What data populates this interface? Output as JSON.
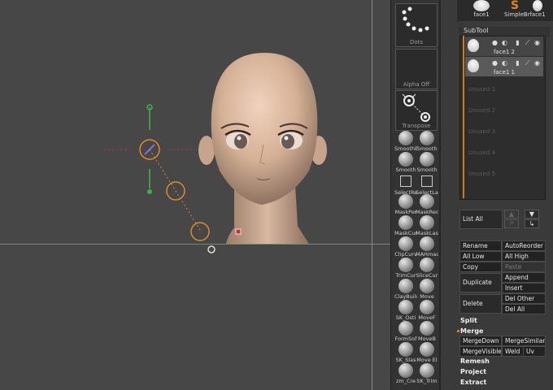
{
  "palette": {
    "dots_label": "Dots",
    "alpha_label": "Alpha Off",
    "transpose_label": "Transpose",
    "brushes": [
      {
        "label": "SmoothE"
      },
      {
        "label": "Smooth"
      },
      {
        "label": "Smooth"
      },
      {
        "label": "Smooth"
      },
      {
        "label": "SelectRe"
      },
      {
        "label": "SelectLa"
      },
      {
        "label": "MaskPer"
      },
      {
        "label": "MaskRec"
      },
      {
        "label": "MaskCur"
      },
      {
        "label": "MaskLas"
      },
      {
        "label": "ClipCurv"
      },
      {
        "label": "MAHmad"
      },
      {
        "label": "TrimCur"
      },
      {
        "label": "SliceCur"
      },
      {
        "label": "ClayBuild"
      },
      {
        "label": "Move"
      },
      {
        "label": "SK_Osti"
      },
      {
        "label": "MoveF"
      },
      {
        "label": "FormSof"
      },
      {
        "label": "MoveB"
      },
      {
        "label": "SK_Slas"
      },
      {
        "label": "Move El"
      },
      {
        "label": "zm_Cre"
      },
      {
        "label": "SK_Trim"
      }
    ]
  },
  "top_tools": {
    "items": [
      {
        "label": "face1"
      },
      {
        "label": "SimpleBr"
      },
      {
        "label": "face1"
      }
    ]
  },
  "subtool": {
    "header": "SubTool",
    "rows": [
      {
        "name": "face1 2"
      },
      {
        "name": "face1 1"
      }
    ],
    "unused": [
      "Unused 1",
      "Unused 2",
      "Unused 3",
      "Unused 4",
      "Unused 5"
    ]
  },
  "buttons": {
    "list_all": "List All",
    "rename": "Rename",
    "auto_reorder": "AutoReorder",
    "all_low": "All Low",
    "all_high": "All High",
    "copy": "Copy",
    "paste": "Paste",
    "duplicate": "Duplicate",
    "append": "Append",
    "insert": "Insert",
    "delete": "Delete",
    "del_other": "Del Other",
    "del_all": "Del All",
    "split": "Split",
    "merge": "Merge",
    "merge_down": "MergeDown",
    "merge_similar": "MergeSimilar",
    "merge_visible": "MergeVisible",
    "weld": "Weld",
    "uv": "Uv",
    "remesh": "Remesh",
    "project": "Project",
    "extract": "Extract"
  },
  "colors": {
    "accent": "#d07a1a",
    "viewport_bg": "#474747",
    "panel_bg": "#3a3a3a"
  }
}
